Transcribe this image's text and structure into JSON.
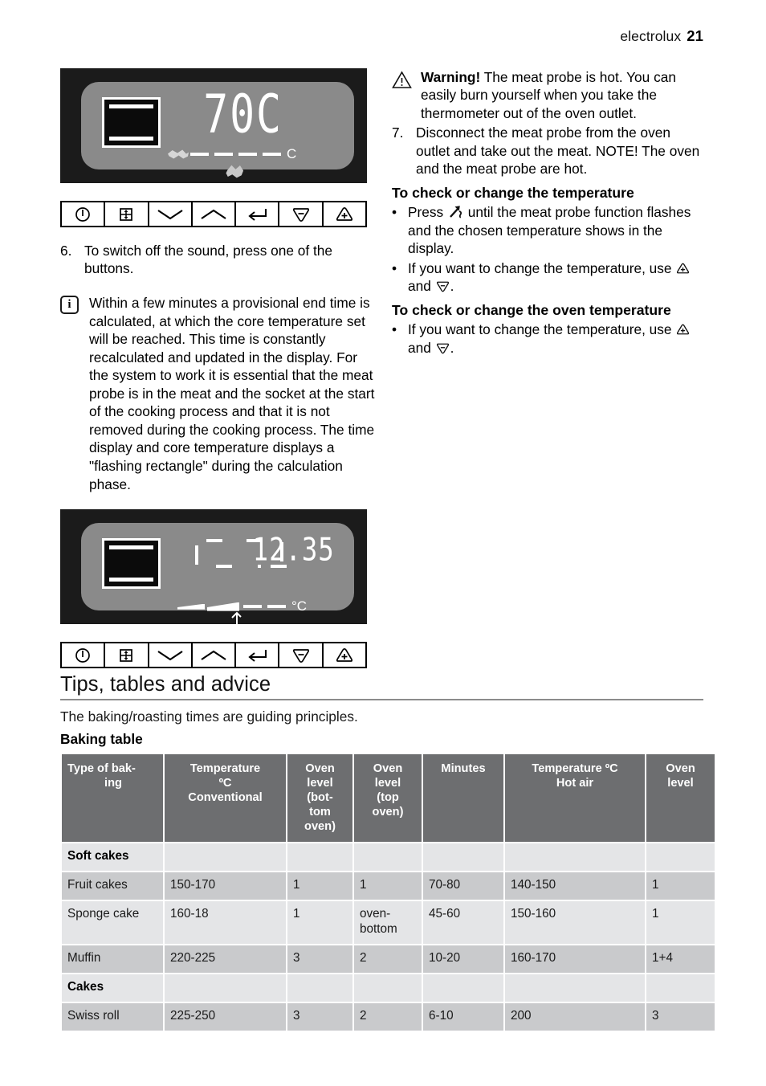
{
  "header": {
    "brand": "electrolux",
    "page": "21"
  },
  "display_one": {
    "value": "70",
    "unit_glyph": "C",
    "scale_unit": "C",
    "icon_box_name": "oven-function-icon",
    "probe_icon": "meat-probe-icon"
  },
  "display_two": {
    "time": "12.35",
    "scale_unit": "°C",
    "flashing_label": "flashing rectangle"
  },
  "buttons": [
    {
      "name": "power-button",
      "icon": "power-icon"
    },
    {
      "name": "oven-level-button",
      "icon": "oven-levels-icon"
    },
    {
      "name": "down-button",
      "icon": "chevron-down-icon"
    },
    {
      "name": "up-button",
      "icon": "chevron-up-icon"
    },
    {
      "name": "enter-button",
      "icon": "enter-arrow-icon"
    },
    {
      "name": "minus-button",
      "icon": "triangle-minus-icon"
    },
    {
      "name": "plus-button",
      "icon": "triangle-plus-icon"
    }
  ],
  "left_column": {
    "step6_number": "6.",
    "step6_text": "To switch off the sound, press one of the buttons.",
    "info_icon_letter": "i",
    "info_text": "Within a few minutes a provisional end time is calculated, at which the core temperature set will be reached. This time is constantly recalculated and updated in the display. For the system to work it is essential that the meat probe is in the meat and the socket at the start of the cooking process and that it is not removed during the cooking process. The time display and core temperature displays a \"flashing rectangle\" during the calculation phase."
  },
  "right_column": {
    "warning_label": "Warning!",
    "warning_text": " The meat probe is hot. You can easily burn yourself when you take the thermometer out of the oven outlet.",
    "step7_number": "7.",
    "step7_text": "Disconnect the meat probe from the oven outlet and take out the meat. NOTE! The oven and the meat probe are hot.",
    "heading_temperature": "To check or change the temperature",
    "bullet_press_pre": "Press ",
    "bullet_press_post": " until the meat probe function flashes and the chosen temperature shows in the display.",
    "bullet_change_pre": "If you want to change the temperature, use ",
    "bullet_change_mid": " and ",
    "bullet_change_post": ".",
    "heading_oven_temperature": "To check or change the oven temperature",
    "bullet_marker": "•"
  },
  "section": {
    "title": "Tips, tables and advice",
    "lead": "The baking/roasting times are guiding principles.",
    "table_title": "Baking table"
  },
  "chart_data": {
    "type": "table",
    "title": "Baking table",
    "columns": [
      "Type of baking",
      "Temperature ºC Conventional",
      "Oven level (bottom oven)",
      "Oven level (top oven)",
      "Minutes",
      "Temperature ºC Hot air",
      "Oven level"
    ],
    "column_parts": [
      {
        "line1": "Type of bak-",
        "line2": "ing"
      },
      {
        "line1": "Temperature",
        "line2": "ºC",
        "line3": "Conventional"
      },
      {
        "line1": "Oven",
        "line2": "level",
        "line3": "(bot-",
        "line4": "tom",
        "line5": "oven)"
      },
      {
        "line1": "Oven",
        "line2": "level",
        "line3": "(top",
        "line4": "oven)"
      },
      {
        "line1": "Minutes"
      },
      {
        "line1": "Temperature ºC",
        "line2": "Hot air"
      },
      {
        "line1": "Oven",
        "line2": "level"
      }
    ],
    "rows": [
      {
        "kind": "category",
        "band": "a",
        "cells": [
          "Soft cakes",
          "",
          "",
          "",
          "",
          "",
          ""
        ]
      },
      {
        "kind": "data",
        "band": "b",
        "cells": [
          "Fruit cakes",
          "150-170",
          "1",
          "1",
          "70-80",
          "140-150",
          "1"
        ]
      },
      {
        "kind": "data",
        "band": "a",
        "cells": [
          "Sponge cake",
          "160-18",
          "1",
          "oven-bottom",
          "45-60",
          "150-160",
          "1"
        ]
      },
      {
        "kind": "data",
        "band": "b",
        "cells": [
          "Muffin",
          "220-225",
          "3",
          "2",
          "10-20",
          "160-170",
          "1+4"
        ]
      },
      {
        "kind": "category",
        "band": "a",
        "cells": [
          "Cakes",
          "",
          "",
          "",
          "",
          "",
          ""
        ]
      },
      {
        "kind": "data",
        "band": "b",
        "cells": [
          "Swiss roll",
          "225-250",
          "3",
          "2",
          "6-10",
          "200",
          "3"
        ]
      }
    ]
  }
}
